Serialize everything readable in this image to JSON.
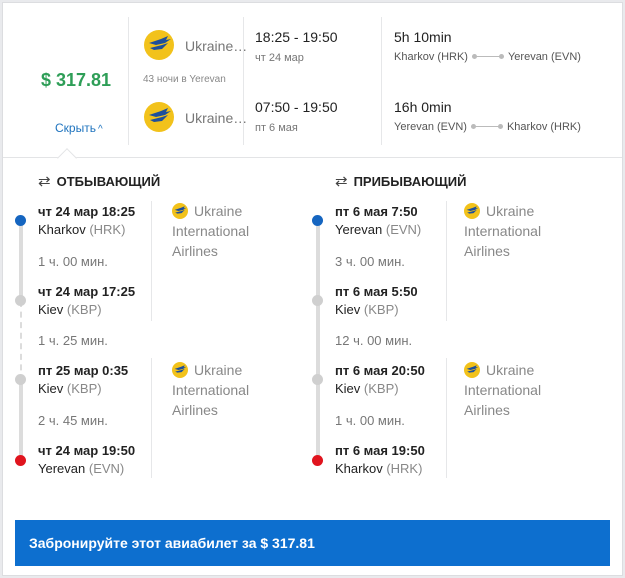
{
  "summary": {
    "price": "$ 317.81",
    "hide_label": "Скрыть",
    "nights": "43 ночи в Yerevan",
    "outbound": {
      "airline": "Ukraine…",
      "time_range": "18:25 - 19:50",
      "date": "чт 24 мар",
      "duration": "5h 10min",
      "from": "Kharkov (HRK)",
      "to": "Yerevan (EVN)"
    },
    "inbound": {
      "airline": "Ukraine…",
      "time_range": "07:50 - 19:50",
      "date": "пт 6 мая",
      "duration": "16h 0min",
      "from": "Yerevan (EVN)",
      "to": "Kharkov (HRK)"
    }
  },
  "departing": {
    "title": "ОТБЫВАЮЩИЙ",
    "stops": [
      {
        "time": "чт 24 мар 18:25",
        "city": "Kharkov",
        "code": "(HRK)"
      },
      {
        "time": "чт 24 мар 17:25",
        "city": "Kiev",
        "code": "(KBP)"
      },
      {
        "time": "пт 25 мар 0:35",
        "city": "Kiev",
        "code": "(KBP)"
      },
      {
        "time": "чт 24 мар 19:50",
        "city": "Yerevan",
        "code": "(EVN)"
      }
    ],
    "durations": [
      "1 ч. 00 мин.",
      "1 ч. 25 мин.",
      "2 ч. 45 мин."
    ],
    "airlines": [
      {
        "line1": "Ukraine",
        "line2": "International",
        "line3": "Airlines"
      },
      {
        "line1": "Ukraine",
        "line2": "International",
        "line3": "Airlines"
      }
    ]
  },
  "arriving": {
    "title": "ПРИБЫВАЮЩИЙ",
    "stops": [
      {
        "time": "пт 6 мая 7:50",
        "city": "Yerevan",
        "code": "(EVN)"
      },
      {
        "time": "пт 6 мая 5:50",
        "city": "Kiev",
        "code": "(KBP)"
      },
      {
        "time": "пт 6 мая 20:50",
        "city": "Kiev",
        "code": "(KBP)"
      },
      {
        "time": "пт 6 мая 19:50",
        "city": "Kharkov",
        "code": "(HRK)"
      }
    ],
    "durations": [
      "3 ч. 00 мин.",
      "12 ч. 00 мин.",
      "1 ч. 00 мин."
    ],
    "airlines": [
      {
        "line1": "Ukraine",
        "line2": "International",
        "line3": "Airlines"
      },
      {
        "line1": "Ukraine",
        "line2": "International",
        "line3": "Airlines"
      }
    ]
  },
  "book_button": "Забронируйте этот авиабилет за $ 317.81",
  "colors": {
    "price": "#2e9e57",
    "link": "#1e73be",
    "button": "#0d6fcf",
    "node_start": "#1565c0",
    "node_end": "#e0141e",
    "logo": "#f2c21b"
  },
  "icons": {
    "airline_logo": "uia-logo-icon",
    "swap": "swap-arrows-icon",
    "chevron": "chevron-up-icon"
  }
}
